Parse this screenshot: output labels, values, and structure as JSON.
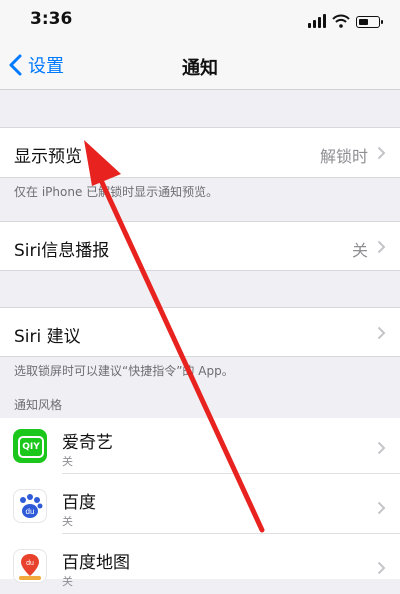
{
  "status_bar": {
    "time": "3:36",
    "battery_level": 0.55
  },
  "nav": {
    "back_label": "设置",
    "title": "通知"
  },
  "show_preview": {
    "label": "显示预览",
    "value": "解锁时",
    "footer": "仅在 iPhone 已解锁时显示通知预览。"
  },
  "siri_announce": {
    "label": "Siri信息播报",
    "value": "关"
  },
  "siri_suggestions": {
    "label": "Siri 建议",
    "footer": "选取锁屏时可以建议“快捷指令”的 App。"
  },
  "notification_style": {
    "header": "通知风格",
    "apps": [
      {
        "name": "爱奇艺",
        "subtitle": "关",
        "icon": "iqiyi-app-icon",
        "icon_text": "QIY",
        "icon_color": "#1cc71c"
      },
      {
        "name": "百度",
        "subtitle": "关",
        "icon": "baidu-app-icon",
        "icon_text": "du",
        "icon_color": "#2f5bd8"
      },
      {
        "name": "百度地图",
        "subtitle": "关",
        "icon": "baidu-map-app-icon",
        "icon_text": "du",
        "icon_color": "#e8412c"
      }
    ]
  },
  "colors": {
    "accent": "#007aff",
    "arrow": "#e8231f"
  }
}
